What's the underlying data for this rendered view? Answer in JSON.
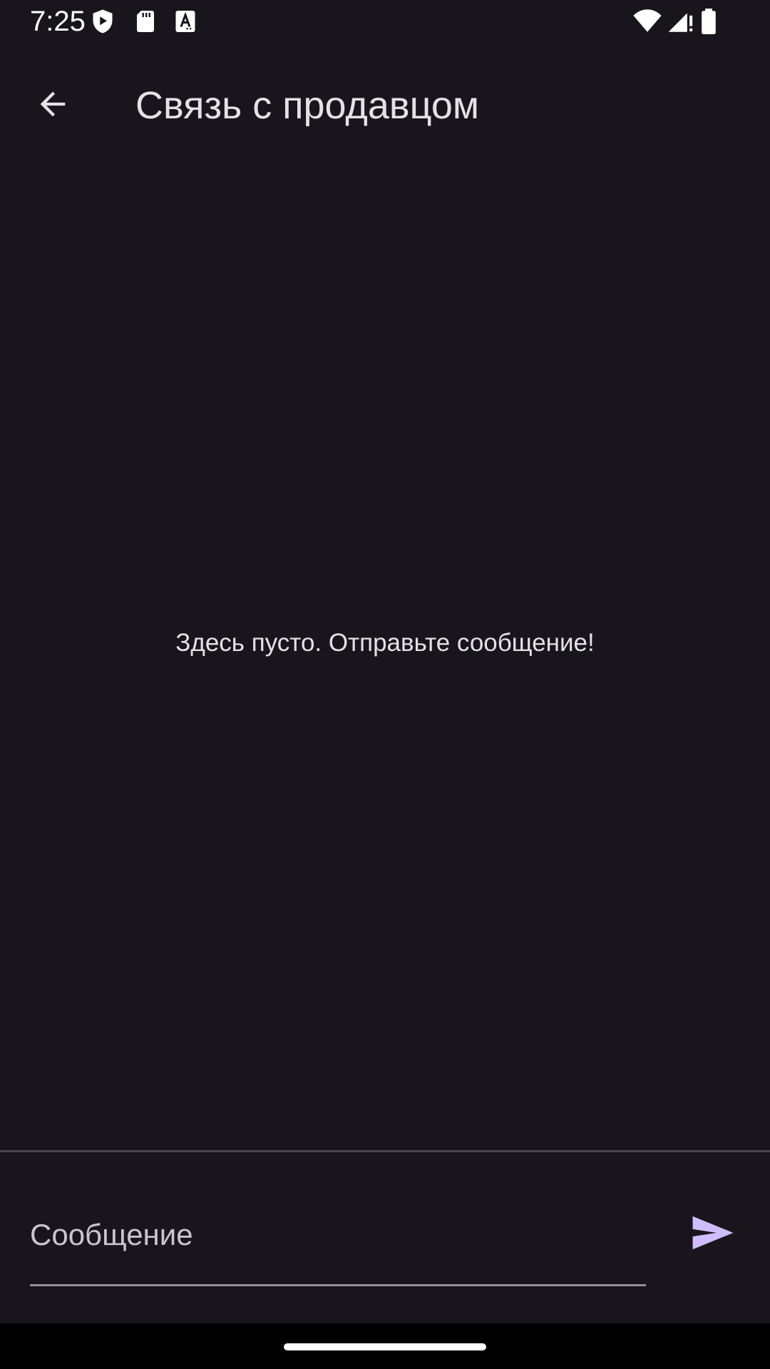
{
  "status_bar": {
    "time": "7:25",
    "icons_left": [
      "shield-play-icon",
      "sd-card-icon",
      "font-a-icon"
    ],
    "icons_right": [
      "wifi-icon",
      "signal-icon",
      "battery-icon"
    ]
  },
  "app_bar": {
    "title": "Связь с продавцом",
    "back_icon": "arrow-back-icon"
  },
  "main": {
    "empty_text": "Здесь пусто. Отправьте сообщение!"
  },
  "composer": {
    "placeholder": "Сообщение",
    "send_icon": "send-icon"
  },
  "colors": {
    "background": "#18161c",
    "accent": "#d0bcff",
    "text": "#e6e1e5"
  }
}
